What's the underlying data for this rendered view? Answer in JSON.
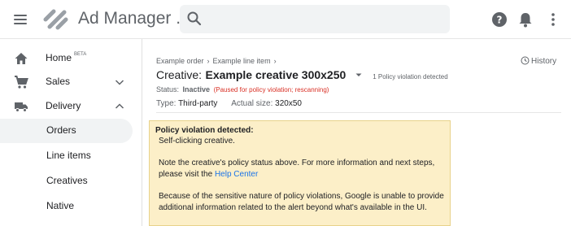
{
  "header": {
    "title": "Ad Manager ...",
    "search": {
      "placeholder": ""
    },
    "icons": [
      "menu-icon",
      "search-icon",
      "help-icon",
      "notifications-icon",
      "more-vert-icon"
    ]
  },
  "sidebar": {
    "items": [
      {
        "label": "Home",
        "sup": "BETA",
        "icon": "home-icon"
      },
      {
        "label": "Sales",
        "icon": "cart-icon",
        "expand": "chevron-down-icon"
      },
      {
        "label": "Delivery",
        "icon": "truck-icon",
        "expand": "chevron-up-icon"
      },
      {
        "label": "Orders",
        "active": true
      },
      {
        "label": "Line items"
      },
      {
        "label": "Creatives"
      },
      {
        "label": "Native"
      }
    ]
  },
  "main": {
    "breadcrumb": [
      "Example order",
      "Example line item"
    ],
    "breadcrumb_sep": "›",
    "history_label": "History",
    "creative_prefix": "Creative:",
    "creative_name": "Example creative 300x250",
    "policy_count": "1 Policy violation detected",
    "status_label": "Status:",
    "status_value": "Inactive",
    "status_note": "(Paused for policy violation; rescanning)",
    "type_label": "Type:",
    "type_value": "Third-party",
    "size_label": "Actual size:",
    "size_value": "320x50"
  },
  "alert": {
    "title": "Policy violation detected:",
    "violation": "Self-clicking creative.",
    "note_line1": "Note the creative's policy status above. For more information and next steps,",
    "note_line2_prefix": "please visit the",
    "help_link": "Help Center",
    "sensitive_line1": "Because of the sensitive nature of policy violations, Google is unable to provide",
    "sensitive_line2": "additional information related to the alert beyond what's available in the UI."
  },
  "colors": {
    "alert_background": "#fcefc8",
    "status_note": "#d93025",
    "link": "#1a73e8",
    "active_nav": "#f1f3f4"
  }
}
